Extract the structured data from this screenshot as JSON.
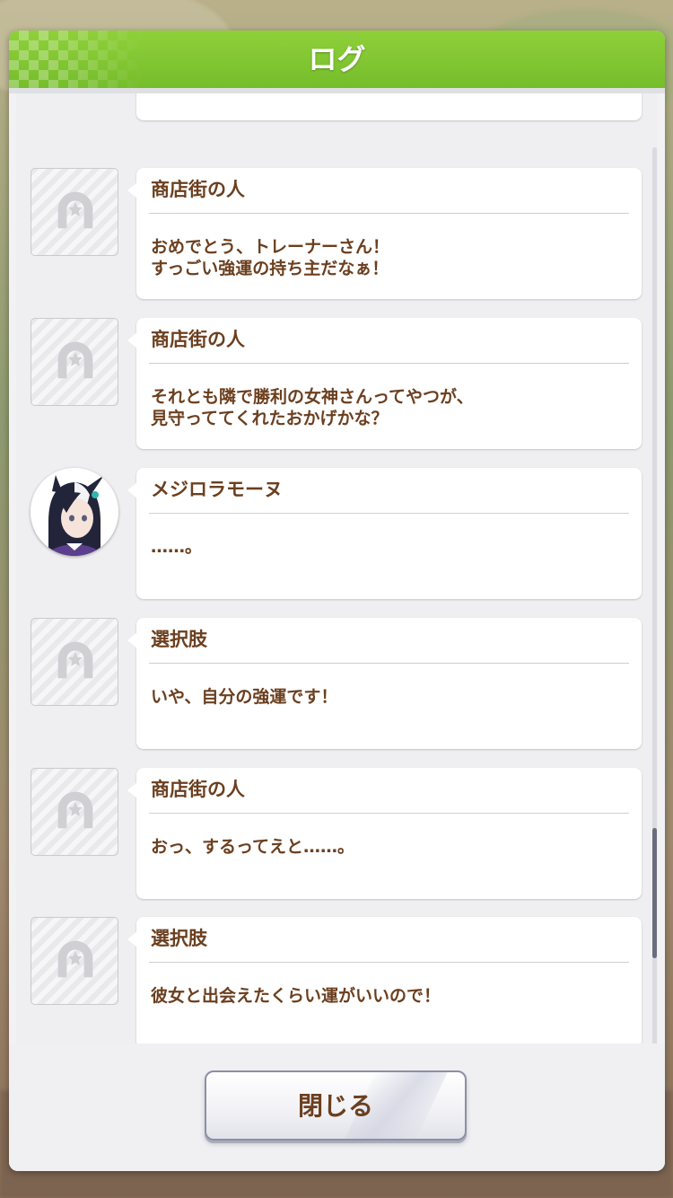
{
  "dialog": {
    "title": "ログ",
    "close_label": "閉じる"
  },
  "entries": [
    {
      "speaker": "商店街の人",
      "message": "おめでとう、トレーナーさん！\nすっごい強運の持ち主だなぁ！",
      "avatar": "horseshoe-placeholder-icon"
    },
    {
      "speaker": "商店街の人",
      "message": "それとも隣で勝利の女神さんってやつが、\n見守っててくれたおかげかな？",
      "avatar": "horseshoe-placeholder-icon"
    },
    {
      "speaker": "メジロラモーヌ",
      "message": "……。",
      "avatar": "character-portrait"
    },
    {
      "speaker": "選択肢",
      "message": "いや、自分の強運です！",
      "avatar": "horseshoe-placeholder-icon"
    },
    {
      "speaker": "商店街の人",
      "message": "おっ、するってえと……。",
      "avatar": "horseshoe-placeholder-icon"
    },
    {
      "speaker": "選択肢",
      "message": "彼女と出会えたくらい運がいいので！",
      "avatar": "horseshoe-placeholder-icon"
    }
  ],
  "colors": {
    "header_green": "#7fc432",
    "text_brown": "#6b3f1f",
    "scroll_thumb": "#6a6d7c"
  }
}
